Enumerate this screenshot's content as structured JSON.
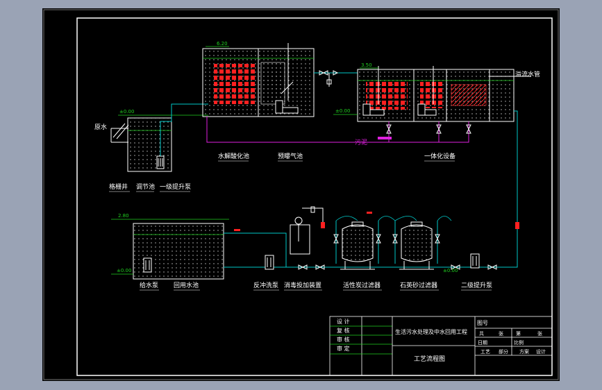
{
  "colors": {
    "background": "#9aa3b5",
    "sheet": "#000000",
    "water": "#00c8c8",
    "sludge": "#e020e0",
    "media": "#ff2020",
    "label": "#ffffff",
    "level": "#20d020"
  },
  "levels": {
    "l_620": "6.20",
    "l_350a": "3.50",
    "l_000a": "±0.00",
    "l_000b": "±0.00",
    "l_280": "2.80",
    "l_000c": "±0.00",
    "l_000d": "±0.00"
  },
  "labels": {
    "raw_water": "原水",
    "overflow_pipe": "溢流水管",
    "sludge": "污泥",
    "grit_well": "格栅井",
    "equalization": "调节池",
    "lift_pump_1": "一级提升泵",
    "hydrolysis": "水解酸化池",
    "pre_aeration": "预曝气池",
    "integrated": "一体化设备",
    "supply_pump": "给水泵",
    "reuse_pool": "回用水池",
    "backwash_pump": "反冲洗泵",
    "dosing": "消毒投加装置",
    "carbon_filter": "活性炭过滤器",
    "sand_filter": "石英砂过滤器",
    "lift_pump_2": "二级提升泵"
  },
  "titleblock": {
    "design": "设 计",
    "review": "复 核",
    "check": "审 核",
    "approve": "审 定",
    "project": "生活污水处理及中水回用工程",
    "drawing_title": "工艺流程图",
    "drawing_no": "图号",
    "sheet_total": "共",
    "sheet_zhang": "张",
    "sheet_no": "第",
    "sheet_zhang2": "张",
    "date": "日期",
    "scale": "比例",
    "process": "工艺",
    "part": "部分",
    "scheme": "方案",
    "stage": "设计"
  }
}
